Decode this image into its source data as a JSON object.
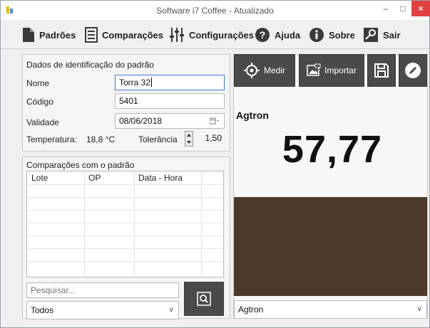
{
  "window": {
    "title": "Software i7 Coffee - Atualizado",
    "min": "–",
    "max": "□",
    "close": "×"
  },
  "menu": [
    {
      "label": "Padrões",
      "icon": "document-icon"
    },
    {
      "label": "Comparações",
      "icon": "notes-icon"
    },
    {
      "label": "Configurações",
      "icon": "sliders-icon"
    },
    {
      "label": "Ajuda",
      "icon": "help-icon"
    },
    {
      "label": "Sobre",
      "icon": "info-icon"
    },
    {
      "label": "Sair",
      "icon": "exit-icon"
    }
  ],
  "standard": {
    "group_title": "Dados de identificação do padrão",
    "name_label": "Nome",
    "name_value": "Torra 32",
    "code_label": "Código",
    "code_value": "5401",
    "validity_label": "Validade",
    "validity_value": "08/06/2018",
    "temperature_label": "Temperatura:",
    "temperature_value": "18,8 °C",
    "tolerance_label": "Tolerância",
    "tolerance_value": "1,50"
  },
  "comparisons": {
    "group_title": "Comparações com o padrão",
    "columns": [
      "Lote",
      "OP",
      "Data - Hora"
    ],
    "rows": [],
    "search_placeholder": "Pesquisar...",
    "filter_value": "Todos"
  },
  "measure": {
    "measure_label": "Medir",
    "import_label": "Importar",
    "agtron_label": "Agtron",
    "agtron_value": "57,77",
    "color_swatch": "#4b3a2c",
    "scale_value": "Agtron"
  }
}
